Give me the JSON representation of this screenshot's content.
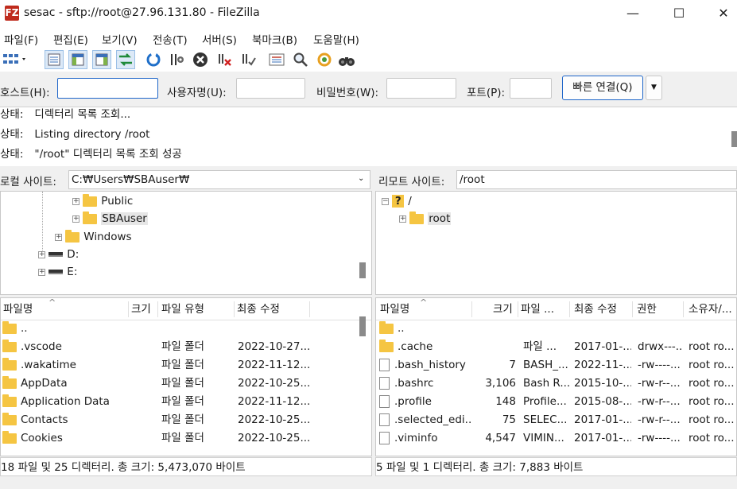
{
  "window": {
    "title": "sesac - sftp://root@27.96.131.80 - FileZilla",
    "app_icon_glyph": "FZ",
    "minimize": "—",
    "maximize": "☐",
    "close": "✕"
  },
  "menu": [
    "파일(F)",
    "편집(E)",
    "보기(V)",
    "전송(T)",
    "서버(S)",
    "북마크(B)",
    "도움말(H)"
  ],
  "quickconnect": {
    "host_label": "호스트(H):",
    "user_label": "사용자명(U):",
    "pass_label": "비밀번호(W):",
    "port_label": "포트(P):",
    "button": "빠른 연결(Q)",
    "host_value": "",
    "user_value": "",
    "pass_value": "",
    "port_value": ""
  },
  "log": [
    {
      "label": "상태:",
      "text": "디렉터리 목록 조회..."
    },
    {
      "label": "상태:",
      "text": "Listing directory /root"
    },
    {
      "label": "상태:",
      "text": "\"/root\" 디렉터리 목록 조회 성공"
    }
  ],
  "local": {
    "site_label": "로컬 사이트:",
    "path": "C:₩Users₩SBAuser₩",
    "tree": [
      {
        "label": "Public",
        "icon": "folder"
      },
      {
        "label": "SBAuser",
        "icon": "folder",
        "selected": true
      },
      {
        "label": "Windows",
        "icon": "folder"
      },
      {
        "label": "D:",
        "icon": "drive"
      },
      {
        "label": "E:",
        "icon": "drive"
      }
    ],
    "columns": [
      "파일명",
      "크기",
      "파일 유형",
      "최종 수정"
    ],
    "files": [
      {
        "name": "..",
        "size": "",
        "type": "",
        "modified": ""
      },
      {
        "name": ".vscode",
        "size": "",
        "type": "파일 폴더",
        "modified": "2022-10-27..."
      },
      {
        "name": ".wakatime",
        "size": "",
        "type": "파일 폴더",
        "modified": "2022-11-12..."
      },
      {
        "name": "AppData",
        "size": "",
        "type": "파일 폴더",
        "modified": "2022-10-25..."
      },
      {
        "name": "Application Data",
        "size": "",
        "type": "파일 폴더",
        "modified": "2022-11-12..."
      },
      {
        "name": "Contacts",
        "size": "",
        "type": "파일 폴더",
        "modified": "2022-10-25..."
      },
      {
        "name": "Cookies",
        "size": "",
        "type": "파일 폴더",
        "modified": "2022-10-25..."
      }
    ],
    "status": "18 파일 및 25 디렉터리. 총 크기: 5,473,070 바이트"
  },
  "remote": {
    "site_label": "리모트 사이트:",
    "path": "/root",
    "tree": [
      {
        "label": "/",
        "icon": "unknown"
      },
      {
        "label": "root",
        "icon": "folder",
        "selected": true
      }
    ],
    "columns": [
      "파일명",
      "크기",
      "파일 ...",
      "최종 수정",
      "권한",
      "소유자/..."
    ],
    "files": [
      {
        "name": "..",
        "size": "",
        "type": "",
        "modified": "",
        "perm": "",
        "owner": "",
        "icon": "folder"
      },
      {
        "name": ".cache",
        "size": "",
        "type": "파일 ...",
        "modified": "2017-01-...",
        "perm": "drwx---...",
        "owner": "root ro...",
        "icon": "folder"
      },
      {
        "name": ".bash_history",
        "size": "7",
        "type": "BASH_...",
        "modified": "2022-11-...",
        "perm": "-rw----...",
        "owner": "root ro...",
        "icon": "file"
      },
      {
        "name": ".bashrc",
        "size": "3,106",
        "type": "Bash R...",
        "modified": "2015-10-...",
        "perm": "-rw-r--...",
        "owner": "root ro...",
        "icon": "file"
      },
      {
        "name": ".profile",
        "size": "148",
        "type": "Profile...",
        "modified": "2015-08-...",
        "perm": "-rw-r--...",
        "owner": "root ro...",
        "icon": "file"
      },
      {
        "name": ".selected_edi...",
        "size": "75",
        "type": "SELEC...",
        "modified": "2017-01-...",
        "perm": "-rw-r--...",
        "owner": "root ro...",
        "icon": "file"
      },
      {
        "name": ".viminfo",
        "size": "4,547",
        "type": "VIMIN...",
        "modified": "2017-01-...",
        "perm": "-rw----...",
        "owner": "root ro...",
        "icon": "file"
      }
    ],
    "status": "5 파일 및 1 디렉터리. 총 크기: 7,883 바이트"
  },
  "colors": {
    "accent": "#1f66c9",
    "folder": "#f5c542",
    "app_icon": "#bf2a1c"
  }
}
